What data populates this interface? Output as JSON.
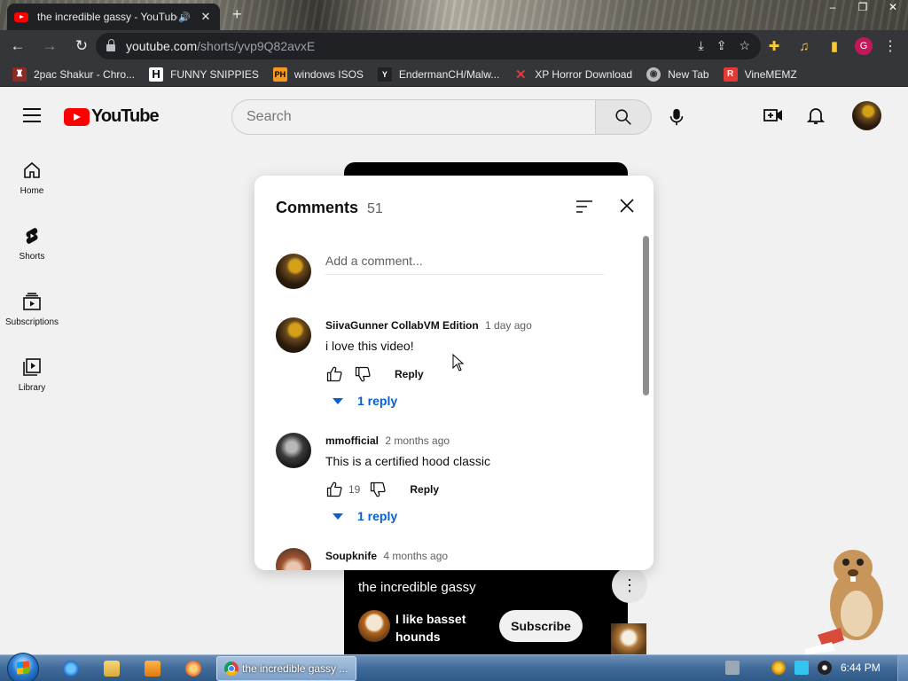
{
  "browser": {
    "tab_title": "the incredible gassy - YouTube",
    "new_tab": "+",
    "address_host": "youtube.com",
    "address_path": "/shorts/yvp9Q82avxE",
    "bookmarks": [
      {
        "label": "2pac Shakur - Chro...",
        "icon": "tupac-icon",
        "color": "#c0392b"
      },
      {
        "label": "FUNNY SNIPPIES",
        "icon": "h-letter-icon",
        "color": "#ffffff"
      },
      {
        "label": "windows ISOS",
        "icon": "ph-icon",
        "color": "#f7971d"
      },
      {
        "label": "EndermanCH/Malw...",
        "icon": "yp-icon",
        "color": "#444444"
      },
      {
        "label": "XP Horror Download",
        "icon": "x-icon",
        "color": "#e53935"
      },
      {
        "label": "New Tab",
        "icon": "globe-icon",
        "color": "#bbbbbb"
      },
      {
        "label": "VineMEMZ",
        "icon": "r-icon",
        "color": "#e53935"
      }
    ],
    "profile_letter": "G"
  },
  "youtube": {
    "logo_text": "YouTube",
    "search_placeholder": "Search",
    "guide": [
      {
        "label": "Home",
        "icon": "home-icon"
      },
      {
        "label": "Shorts",
        "icon": "shorts-icon"
      },
      {
        "label": "Subscriptions",
        "icon": "subscriptions-icon"
      },
      {
        "label": "Library",
        "icon": "library-icon"
      }
    ],
    "short": {
      "title": "the incredible gassy",
      "channel": "I like basset hounds",
      "subscribe": "Subscribe",
      "more": "⋮"
    },
    "comments": {
      "title": "Comments",
      "count": "51",
      "add_placeholder": "Add a comment...",
      "items": [
        {
          "author": "SiivaGunner CollabVM Edition",
          "time": "1 day ago",
          "text": "i love this video!",
          "likes": "",
          "reply": "Reply",
          "replies": "1 reply"
        },
        {
          "author": "mmofficial",
          "time": "2 months ago",
          "text": "This is a certified hood classic",
          "likes": "19",
          "reply": "Reply",
          "replies": "1 reply"
        },
        {
          "author": "Soupknife",
          "time": "4 months ago",
          "text": "",
          "likes": "",
          "reply": "",
          "replies": ""
        }
      ]
    }
  },
  "taskbar": {
    "active_window": "the incredible gassy ...",
    "clock": "6:44 PM"
  },
  "colors": {
    "youtube_red": "#ff0000",
    "link_blue": "#065fd4",
    "chrome_dark": "#35363a"
  }
}
